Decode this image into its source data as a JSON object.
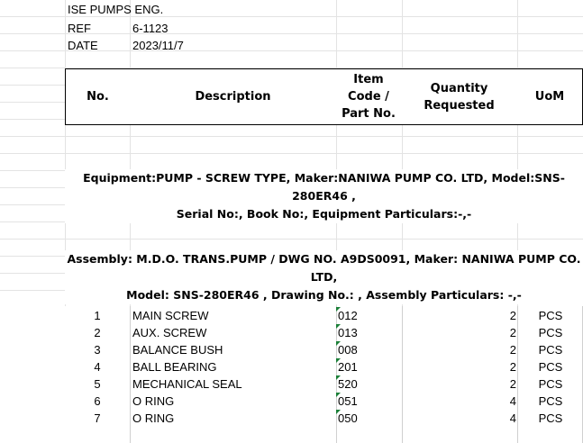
{
  "header": {
    "company": "ISE PUMPS ENG.",
    "ref_label": "REF",
    "ref_value": "6-1123",
    "date_label": "DATE",
    "date_value": "2023/11/7"
  },
  "table": {
    "columns": {
      "no": "No.",
      "description": "Description",
      "code_l1": "Item",
      "code_l2": "Code /",
      "code_l3": "Part No.",
      "qty_l1": "Quantity",
      "qty_l2": "Requested",
      "uom": "UoM"
    },
    "equipment_l1": "Equipment:PUMP - SCREW TYPE, Maker:NANIWA PUMP CO. LTD, Model:SNS-280ER46 ,",
    "equipment_l2": "Serial No:, Book No:, Equipment Particulars:-,-",
    "assembly_l1": "Assembly: M.D.O. TRANS.PUMP  / DWG NO. A9DS0091, Maker: NANIWA PUMP CO. LTD,",
    "assembly_l2": "Model: SNS-280ER46 , Drawing No.: , Assembly Particulars: -,-",
    "rows": [
      {
        "no": "1",
        "desc": "MAIN SCREW",
        "code": "012",
        "qty": "2",
        "uom": "PCS"
      },
      {
        "no": "2",
        "desc": "AUX. SCREW",
        "code": "013",
        "qty": "2",
        "uom": "PCS"
      },
      {
        "no": "3",
        "desc": "BALANCE BUSH",
        "code": "008",
        "qty": "2",
        "uom": "PCS"
      },
      {
        "no": "4",
        "desc": "BALL BEARING",
        "code": "201",
        "qty": "2",
        "uom": "PCS"
      },
      {
        "no": "5",
        "desc": "MECHANICAL SEAL",
        "code": "520",
        "qty": "2",
        "uom": "PCS"
      },
      {
        "no": "6",
        "desc": "O RING",
        "code": "051",
        "qty": "4",
        "uom": "PCS"
      },
      {
        "no": "7",
        "desc": "O RING",
        "code": "050",
        "qty": "4",
        "uom": "PCS"
      }
    ]
  }
}
